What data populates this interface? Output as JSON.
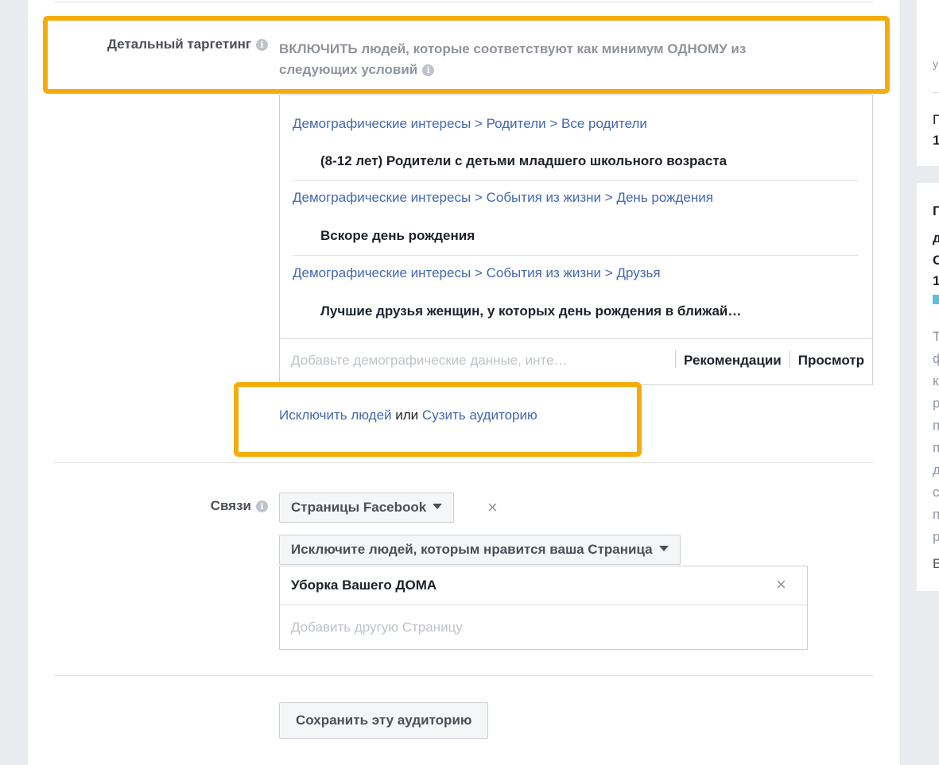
{
  "detailed_targeting": {
    "label": "Детальный таргетинг",
    "info_icon": "info-icon",
    "include_text_line1": "ВКЛЮЧИТЬ людей, которые соответствуют как минимум ОДНОМУ из",
    "include_text_line2": "следующих условий",
    "groups": [
      {
        "path": [
          "Демографические интересы",
          "Родители",
          "Все родители"
        ],
        "item": "(8-12 лет) Родители с детьми младшего школьного возраста"
      },
      {
        "path": [
          "Демографические интересы",
          "События из жизни",
          "День рождения"
        ],
        "item": "Вскоре день рождения"
      },
      {
        "path": [
          "Демографические интересы",
          "События из жизни",
          "Друзья"
        ],
        "item": "Лучшие друзья женщин, у которых день рождения в ближай…"
      }
    ],
    "path_separator": ">",
    "input_placeholder": "Добавьте демографические данные, инте…",
    "recommendations_label": "Рекомендации",
    "browse_label": "Просмотр",
    "exclude_link": "Исключить людей",
    "or_text": "или",
    "narrow_link": "Сузить аудиторию"
  },
  "connections": {
    "label": "Связи",
    "dropdown_label": "Страницы Facebook",
    "exclude_dropdown_label": "Исключите людей, которым нравится ваша Страница",
    "selected_page": "Уборка Вашего ДОМА",
    "add_page_placeholder": "Добавить другую Страницу",
    "remove_symbol": "×"
  },
  "save_audience_label": "Сохранить эту аудиторию",
  "side_panel_fragments": {
    "top": [
      "у",
      "П",
      "1"
    ],
    "bottom": [
      "П",
      "д",
      "С",
      "1",
      "Т",
      "ф",
      "к",
      "р",
      "п",
      "п",
      "д",
      "с",
      "п",
      "р",
      "В"
    ]
  },
  "colors": {
    "highlight": "#f5ac0a",
    "link": "#4267b2",
    "accent_bar": "#5bc0de"
  }
}
